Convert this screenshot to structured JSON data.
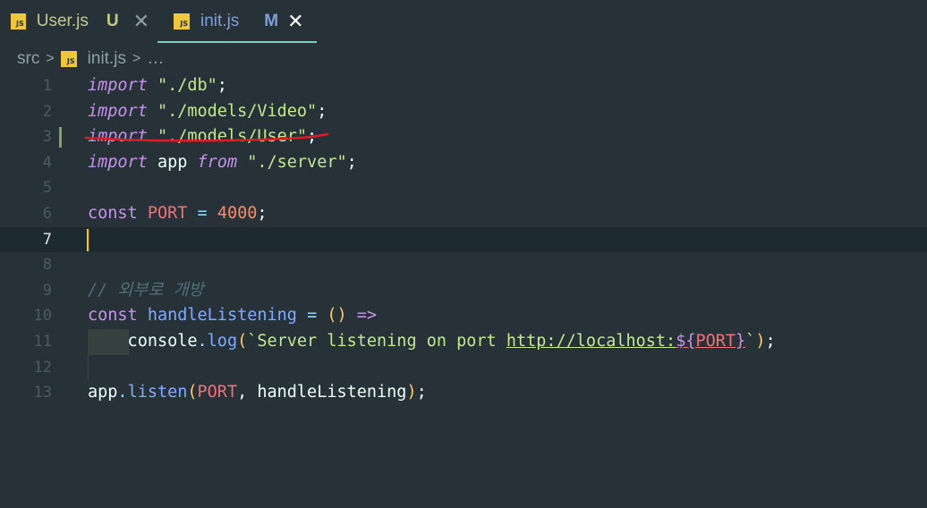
{
  "tabs": [
    {
      "name": "User.js",
      "status": "U",
      "close": "✕",
      "icon": "JS"
    },
    {
      "name": "init.js",
      "status": "M",
      "close": "✕",
      "icon": "JS"
    }
  ],
  "breadcrumb": {
    "folder": "src",
    "separator": ">",
    "file": "init.js",
    "more": "…",
    "icon": "JS"
  },
  "lines": [
    {
      "n": "1",
      "tokens": [
        {
          "t": "import",
          "c": "kw"
        },
        {
          "t": " ",
          "c": "plain"
        },
        {
          "t": "\"./db\"",
          "c": "str"
        },
        {
          "t": ";",
          "c": "plain"
        }
      ]
    },
    {
      "n": "2",
      "tokens": [
        {
          "t": "import",
          "c": "kw"
        },
        {
          "t": " ",
          "c": "plain"
        },
        {
          "t": "\"./models/Video\"",
          "c": "str"
        },
        {
          "t": ";",
          "c": "plain"
        }
      ]
    },
    {
      "n": "3",
      "tokens": [
        {
          "t": "import",
          "c": "kw"
        },
        {
          "t": " ",
          "c": "plain"
        },
        {
          "t": "\"./models/User\"",
          "c": "str"
        },
        {
          "t": ";",
          "c": "plain"
        }
      ]
    },
    {
      "n": "4",
      "tokens": [
        {
          "t": "import",
          "c": "kw"
        },
        {
          "t": " app ",
          "c": "plain"
        },
        {
          "t": "from",
          "c": "kw"
        },
        {
          "t": " ",
          "c": "plain"
        },
        {
          "t": "\"./server\"",
          "c": "str"
        },
        {
          "t": ";",
          "c": "plain"
        }
      ]
    },
    {
      "n": "5",
      "tokens": []
    },
    {
      "n": "6",
      "tokens": [
        {
          "t": "const",
          "c": "const"
        },
        {
          "t": " ",
          "c": "plain"
        },
        {
          "t": "PORT",
          "c": "var"
        },
        {
          "t": " ",
          "c": "plain"
        },
        {
          "t": "=",
          "c": "op"
        },
        {
          "t": " ",
          "c": "plain"
        },
        {
          "t": "4000",
          "c": "num"
        },
        {
          "t": ";",
          "c": "plain"
        }
      ]
    },
    {
      "n": "7",
      "tokens": []
    },
    {
      "n": "8",
      "tokens": []
    },
    {
      "n": "9",
      "tokens": [
        {
          "t": "// 외부로 개방",
          "c": "comment"
        }
      ]
    },
    {
      "n": "10",
      "tokens": [
        {
          "t": "const",
          "c": "const"
        },
        {
          "t": " ",
          "c": "plain"
        },
        {
          "t": "handleListening",
          "c": "fn"
        },
        {
          "t": " ",
          "c": "plain"
        },
        {
          "t": "=",
          "c": "op"
        },
        {
          "t": " ",
          "c": "plain"
        },
        {
          "t": "()",
          "c": "paren"
        },
        {
          "t": " ",
          "c": "plain"
        },
        {
          "t": "=>",
          "c": "const"
        }
      ]
    },
    {
      "n": "11",
      "tokens": [
        {
          "t": "    console",
          "c": "plain"
        },
        {
          "t": ".",
          "c": "dot"
        },
        {
          "t": "log",
          "c": "fn"
        },
        {
          "t": "(",
          "c": "paren"
        },
        {
          "t": "`Server listening on port ",
          "c": "str"
        },
        {
          "t": "http://localhost:",
          "c": "str url-ul"
        },
        {
          "t": "${",
          "c": "tmpl interp-ul"
        },
        {
          "t": "PORT",
          "c": "var interp-ul"
        },
        {
          "t": "}",
          "c": "tmpl interp-ul"
        },
        {
          "t": "`",
          "c": "str"
        },
        {
          "t": ")",
          "c": "paren"
        },
        {
          "t": ";",
          "c": "plain"
        }
      ]
    },
    {
      "n": "12",
      "tokens": []
    },
    {
      "n": "13",
      "tokens": [
        {
          "t": "app",
          "c": "plain"
        },
        {
          "t": ".",
          "c": "dot"
        },
        {
          "t": "listen",
          "c": "fn"
        },
        {
          "t": "(",
          "c": "paren"
        },
        {
          "t": "PORT",
          "c": "var"
        },
        {
          "t": ", handleListening",
          "c": "plain"
        },
        {
          "t": ")",
          "c": "paren"
        },
        {
          "t": ";",
          "c": "plain"
        }
      ]
    }
  ],
  "current_line": "7",
  "colors": {
    "background": "#263238",
    "accent": "#80cbc4",
    "annotation": "#e01b24"
  }
}
